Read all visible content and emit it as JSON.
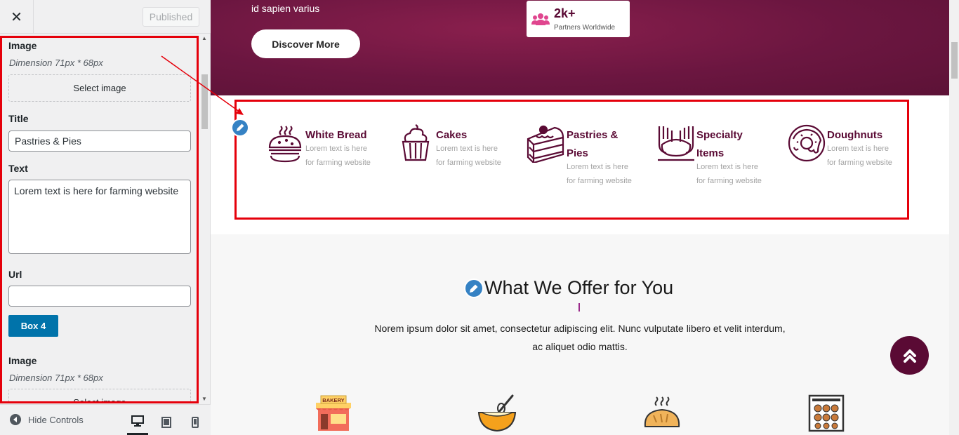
{
  "panel": {
    "close_glyph": "✕",
    "publish_label": "Published",
    "fields": {
      "image_label_1": "Image",
      "dimension_1": "Dimension 71px * 68px",
      "select_image_1": "Select image",
      "title_label": "Title",
      "title_value": "Pastries & Pies",
      "text_label": "Text",
      "text_value": "Lorem text is here for farming website",
      "url_label": "Url",
      "url_value": "",
      "box_button": "Box 4",
      "image_label_2": "Image",
      "dimension_2": "Dimension 71px * 68px",
      "select_image_2": "Select image"
    },
    "footer": {
      "hide_controls": "Hide Controls"
    }
  },
  "hero": {
    "text": "id sapien varius",
    "discover_button": "Discover More",
    "stat_value": "2k+",
    "stat_label": "Partners Worldwide"
  },
  "categories": [
    {
      "title": "White Bread",
      "text": "Lorem text is here for farming website",
      "icon": "burger-bun-icon"
    },
    {
      "title": "Cakes",
      "text": "Lorem text is here for farming website",
      "icon": "cupcake-icon"
    },
    {
      "title": "Pastries & Pies",
      "text": "Lorem text is here for farming website",
      "icon": "cake-slice-icon"
    },
    {
      "title": "Specialty Items",
      "text": "Lorem text is here for farming website",
      "icon": "hands-dough-icon"
    },
    {
      "title": "Doughnuts",
      "text": "Lorem text is here for farming website",
      "icon": "doughnut-icon"
    }
  ],
  "offer": {
    "title": "What We Offer for You",
    "description": "Norem ipsum dolor sit amet, consectetur adipiscing elit. Nunc vulputate libero et velit interdum, ac aliquet odio mattis.",
    "bakery_sign": "BAKERY",
    "icons": [
      "bakery-shop-icon",
      "mixing-bowl-icon",
      "bread-loaf-icon",
      "oven-tray-icon"
    ]
  },
  "colors": {
    "brand": "#5a0a34",
    "highlight": "#e5000b",
    "wp_blue": "#0073aa"
  }
}
